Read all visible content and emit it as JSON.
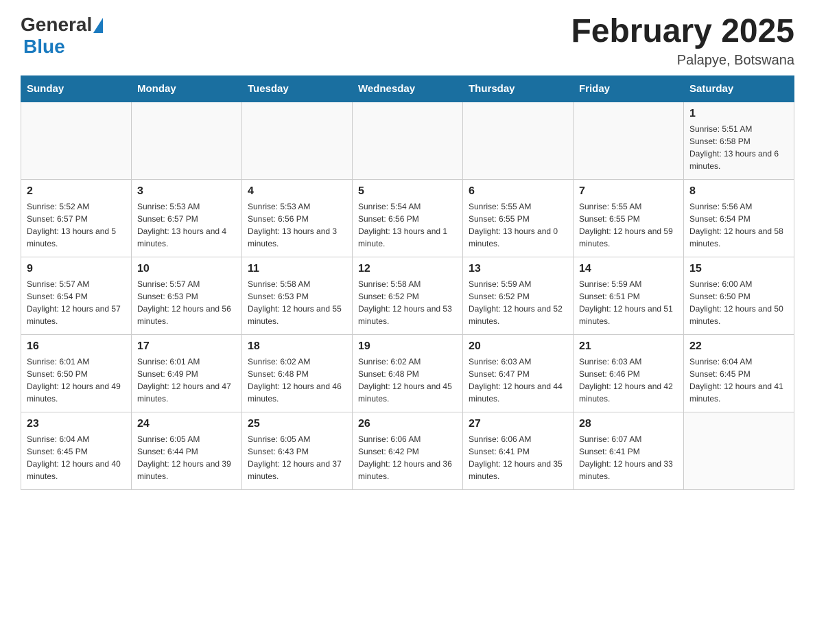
{
  "header": {
    "logo_general": "General",
    "logo_blue": "Blue",
    "title": "February 2025",
    "location": "Palapye, Botswana"
  },
  "calendar": {
    "days_of_week": [
      "Sunday",
      "Monday",
      "Tuesday",
      "Wednesday",
      "Thursday",
      "Friday",
      "Saturday"
    ],
    "weeks": [
      [
        {
          "day": "",
          "info": ""
        },
        {
          "day": "",
          "info": ""
        },
        {
          "day": "",
          "info": ""
        },
        {
          "day": "",
          "info": ""
        },
        {
          "day": "",
          "info": ""
        },
        {
          "day": "",
          "info": ""
        },
        {
          "day": "1",
          "info": "Sunrise: 5:51 AM\nSunset: 6:58 PM\nDaylight: 13 hours and 6 minutes."
        }
      ],
      [
        {
          "day": "2",
          "info": "Sunrise: 5:52 AM\nSunset: 6:57 PM\nDaylight: 13 hours and 5 minutes."
        },
        {
          "day": "3",
          "info": "Sunrise: 5:53 AM\nSunset: 6:57 PM\nDaylight: 13 hours and 4 minutes."
        },
        {
          "day": "4",
          "info": "Sunrise: 5:53 AM\nSunset: 6:56 PM\nDaylight: 13 hours and 3 minutes."
        },
        {
          "day": "5",
          "info": "Sunrise: 5:54 AM\nSunset: 6:56 PM\nDaylight: 13 hours and 1 minute."
        },
        {
          "day": "6",
          "info": "Sunrise: 5:55 AM\nSunset: 6:55 PM\nDaylight: 13 hours and 0 minutes."
        },
        {
          "day": "7",
          "info": "Sunrise: 5:55 AM\nSunset: 6:55 PM\nDaylight: 12 hours and 59 minutes."
        },
        {
          "day": "8",
          "info": "Sunrise: 5:56 AM\nSunset: 6:54 PM\nDaylight: 12 hours and 58 minutes."
        }
      ],
      [
        {
          "day": "9",
          "info": "Sunrise: 5:57 AM\nSunset: 6:54 PM\nDaylight: 12 hours and 57 minutes."
        },
        {
          "day": "10",
          "info": "Sunrise: 5:57 AM\nSunset: 6:53 PM\nDaylight: 12 hours and 56 minutes."
        },
        {
          "day": "11",
          "info": "Sunrise: 5:58 AM\nSunset: 6:53 PM\nDaylight: 12 hours and 55 minutes."
        },
        {
          "day": "12",
          "info": "Sunrise: 5:58 AM\nSunset: 6:52 PM\nDaylight: 12 hours and 53 minutes."
        },
        {
          "day": "13",
          "info": "Sunrise: 5:59 AM\nSunset: 6:52 PM\nDaylight: 12 hours and 52 minutes."
        },
        {
          "day": "14",
          "info": "Sunrise: 5:59 AM\nSunset: 6:51 PM\nDaylight: 12 hours and 51 minutes."
        },
        {
          "day": "15",
          "info": "Sunrise: 6:00 AM\nSunset: 6:50 PM\nDaylight: 12 hours and 50 minutes."
        }
      ],
      [
        {
          "day": "16",
          "info": "Sunrise: 6:01 AM\nSunset: 6:50 PM\nDaylight: 12 hours and 49 minutes."
        },
        {
          "day": "17",
          "info": "Sunrise: 6:01 AM\nSunset: 6:49 PM\nDaylight: 12 hours and 47 minutes."
        },
        {
          "day": "18",
          "info": "Sunrise: 6:02 AM\nSunset: 6:48 PM\nDaylight: 12 hours and 46 minutes."
        },
        {
          "day": "19",
          "info": "Sunrise: 6:02 AM\nSunset: 6:48 PM\nDaylight: 12 hours and 45 minutes."
        },
        {
          "day": "20",
          "info": "Sunrise: 6:03 AM\nSunset: 6:47 PM\nDaylight: 12 hours and 44 minutes."
        },
        {
          "day": "21",
          "info": "Sunrise: 6:03 AM\nSunset: 6:46 PM\nDaylight: 12 hours and 42 minutes."
        },
        {
          "day": "22",
          "info": "Sunrise: 6:04 AM\nSunset: 6:45 PM\nDaylight: 12 hours and 41 minutes."
        }
      ],
      [
        {
          "day": "23",
          "info": "Sunrise: 6:04 AM\nSunset: 6:45 PM\nDaylight: 12 hours and 40 minutes."
        },
        {
          "day": "24",
          "info": "Sunrise: 6:05 AM\nSunset: 6:44 PM\nDaylight: 12 hours and 39 minutes."
        },
        {
          "day": "25",
          "info": "Sunrise: 6:05 AM\nSunset: 6:43 PM\nDaylight: 12 hours and 37 minutes."
        },
        {
          "day": "26",
          "info": "Sunrise: 6:06 AM\nSunset: 6:42 PM\nDaylight: 12 hours and 36 minutes."
        },
        {
          "day": "27",
          "info": "Sunrise: 6:06 AM\nSunset: 6:41 PM\nDaylight: 12 hours and 35 minutes."
        },
        {
          "day": "28",
          "info": "Sunrise: 6:07 AM\nSunset: 6:41 PM\nDaylight: 12 hours and 33 minutes."
        },
        {
          "day": "",
          "info": ""
        }
      ]
    ]
  }
}
